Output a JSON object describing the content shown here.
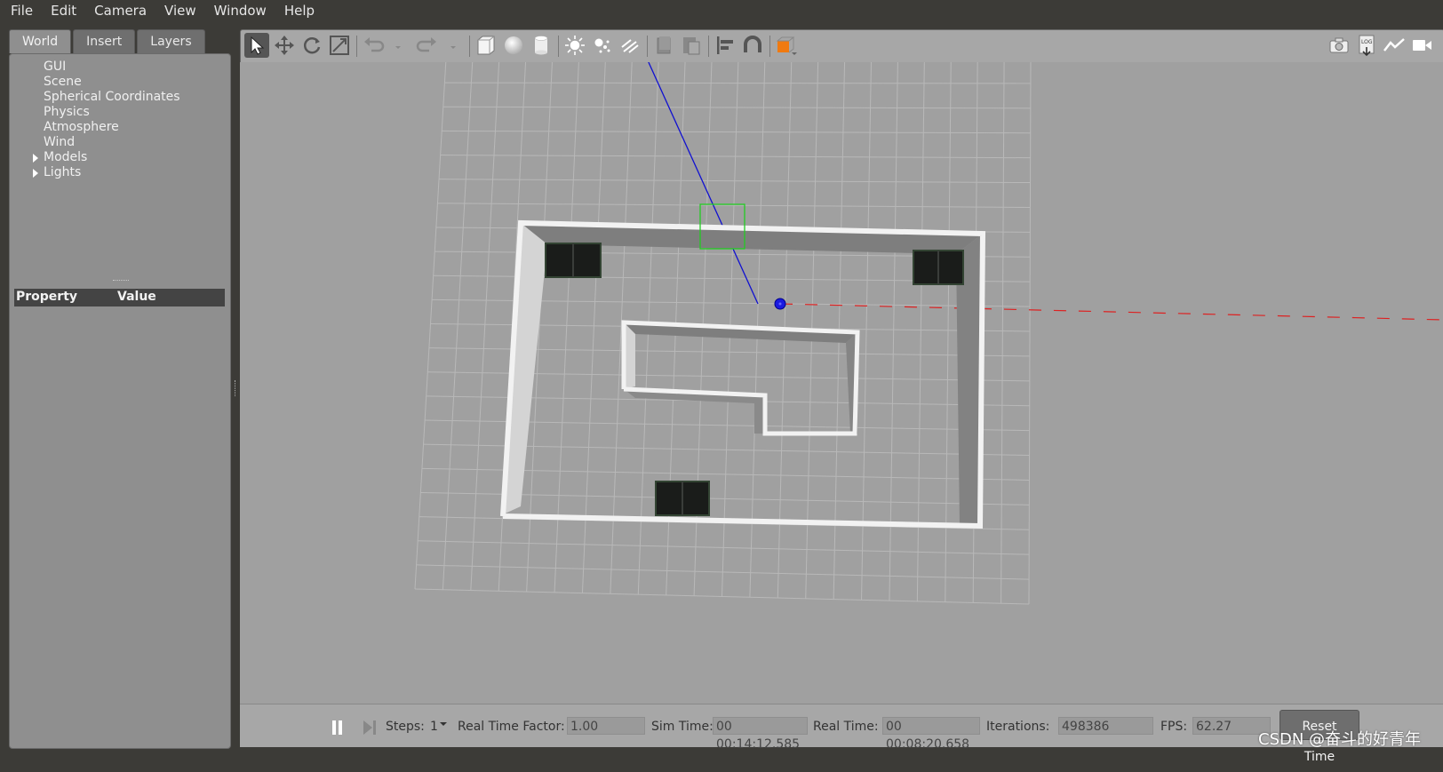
{
  "menu": [
    "File",
    "Edit",
    "Camera",
    "View",
    "Window",
    "Help"
  ],
  "tabs": [
    "World",
    "Insert",
    "Layers"
  ],
  "tree": [
    {
      "label": "GUI",
      "expandable": false
    },
    {
      "label": "Scene",
      "expandable": false
    },
    {
      "label": "Spherical Coordinates",
      "expandable": false
    },
    {
      "label": "Physics",
      "expandable": false
    },
    {
      "label": "Atmosphere",
      "expandable": false
    },
    {
      "label": "Wind",
      "expandable": false
    },
    {
      "label": "Models",
      "expandable": true
    },
    {
      "label": "Lights",
      "expandable": true
    }
  ],
  "property_header": {
    "property": "Property",
    "value": "Value"
  },
  "toolbar_icons": [
    "select-arrow-icon",
    "translate-icon",
    "rotate-icon",
    "scale-icon",
    "undo-icon",
    "undo-dropdown-icon",
    "redo-icon",
    "redo-dropdown-icon",
    "box-shape-icon",
    "sphere-shape-icon",
    "cylinder-shape-icon",
    "point-light-icon",
    "spot-light-icon",
    "directional-light-icon",
    "copy-icon",
    "paste-icon",
    "align-icon",
    "snap-icon",
    "view-angle-icon",
    "screenshot-icon",
    "log-icon",
    "plot-icon",
    "record-video-icon"
  ],
  "bottom": {
    "steps_label": "Steps:",
    "steps_value": "1",
    "rtf_label": "Real Time Factor:",
    "rtf_value": "1.00",
    "sim_time_label": "Sim Time:",
    "sim_time_value": "00 00:14:12.585",
    "real_time_label": "Real Time:",
    "real_time_value": "00 00:08:20.658",
    "iterations_label": "Iterations:",
    "iterations_value": "498386",
    "fps_label": "FPS:",
    "fps_value": "62.27",
    "reset_label": "Reset Time"
  },
  "watermark": "CSDN @奋斗的好青年",
  "colors": {
    "background": "#a0a0a0",
    "grid": "#b8b8b8",
    "wall": "#f2f2f2",
    "blue_axis": "#1010d0",
    "red_axis": "#dd2222",
    "selection_box": "#22cc22"
  }
}
